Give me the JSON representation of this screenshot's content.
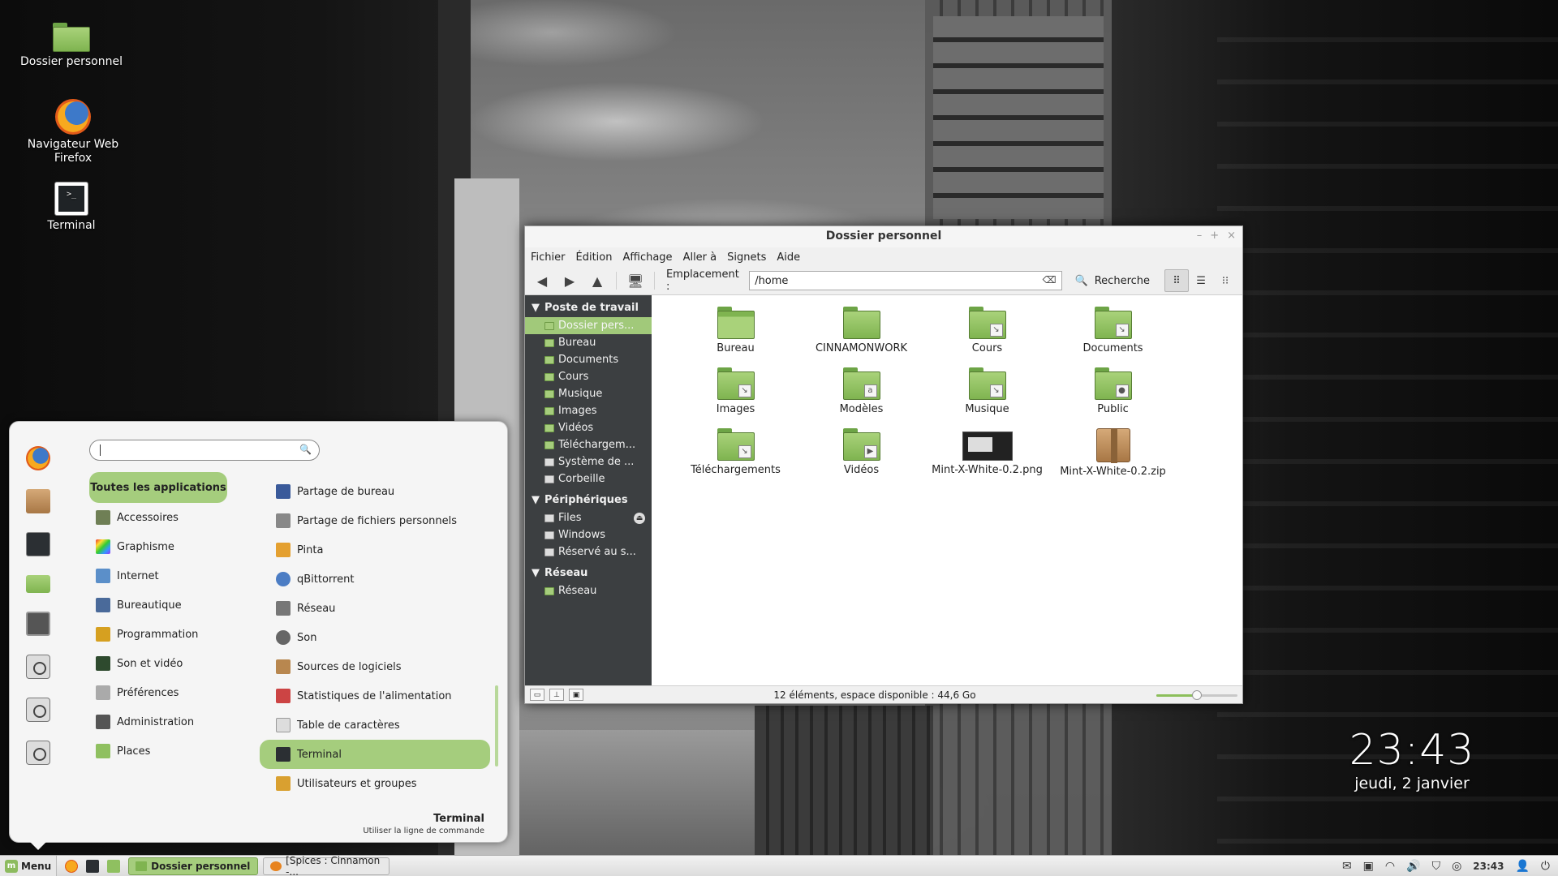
{
  "desktop": {
    "icons": [
      {
        "label": "Dossier personnel",
        "icon": "home-folder-icon"
      },
      {
        "label": "Navigateur Web\nFirefox",
        "label_line1": "Navigateur Web",
        "label_line2": "Firefox",
        "icon": "firefox-icon"
      },
      {
        "label": "Terminal",
        "icon": "terminal-icon"
      }
    ]
  },
  "file_manager": {
    "title": "Dossier personnel",
    "window_buttons": {
      "minimize": "–",
      "maximize": "+",
      "close": "×"
    },
    "menu": [
      "Fichier",
      "Édition",
      "Affichage",
      "Aller à",
      "Signets",
      "Aide"
    ],
    "location_label": "Emplacement :",
    "location_value": "/home",
    "search_label": "Recherche",
    "sidebar": {
      "sections": [
        {
          "title": "Poste de travail",
          "items": [
            {
              "label": "Dossier pers...",
              "selected": true
            },
            {
              "label": "Bureau"
            },
            {
              "label": "Documents"
            },
            {
              "label": "Cours"
            },
            {
              "label": "Musique"
            },
            {
              "label": "Images"
            },
            {
              "label": "Vidéos"
            },
            {
              "label": "Téléchargem..."
            },
            {
              "label": "Système de ..."
            },
            {
              "label": "Corbeille"
            }
          ]
        },
        {
          "title": "Périphériques",
          "items": [
            {
              "label": "Files"
            },
            {
              "label": "Windows"
            },
            {
              "label": "Réservé au s..."
            }
          ]
        },
        {
          "title": "Réseau",
          "items": [
            {
              "label": "Réseau"
            }
          ]
        }
      ]
    },
    "files": [
      {
        "name": "Bureau",
        "type": "folder"
      },
      {
        "name": "CINNAMONWORK",
        "type": "folder"
      },
      {
        "name": "Cours",
        "type": "folder-link"
      },
      {
        "name": "Documents",
        "type": "folder-link"
      },
      {
        "name": "Images",
        "type": "folder-link"
      },
      {
        "name": "Modèles",
        "type": "folder-link"
      },
      {
        "name": "Musique",
        "type": "folder-link"
      },
      {
        "name": "Public",
        "type": "folder-link"
      },
      {
        "name": "Téléchargements",
        "type": "folder-link"
      },
      {
        "name": "Vidéos",
        "type": "folder-link"
      },
      {
        "name": "Mint-X-White-0.2.png",
        "type": "image"
      },
      {
        "name": "Mint-X-White-0.2.zip",
        "type": "archive"
      }
    ],
    "status": "12 éléments, espace disponible : 44,6 Go",
    "zoom_level": 0.5
  },
  "start_menu": {
    "search_placeholder": "",
    "all_apps_label": "Toutes les applications",
    "favorites": [
      "firefox-icon",
      "package-icon",
      "terminal-icon",
      "folder-icon",
      "settings-icon",
      "lock-icon",
      "logout-icon",
      "power-icon"
    ],
    "categories": [
      "Accessoires",
      "Graphisme",
      "Internet",
      "Bureautique",
      "Programmation",
      "Son et vidéo",
      "Préférences",
      "Administration",
      "Places"
    ],
    "apps": [
      {
        "label": "Partage de bureau"
      },
      {
        "label": "Partage de fichiers personnels"
      },
      {
        "label": "Pinta"
      },
      {
        "label": "qBittorrent"
      },
      {
        "label": "Réseau"
      },
      {
        "label": "Son"
      },
      {
        "label": "Sources de logiciels"
      },
      {
        "label": "Statistiques de l'alimentation"
      },
      {
        "label": "Table de caractères"
      },
      {
        "label": "Terminal",
        "selected": true
      },
      {
        "label": "Utilisateurs et groupes"
      }
    ],
    "description_title": "Terminal",
    "description_text": "Utiliser la ligne de commande"
  },
  "clock": {
    "time": "23:43",
    "date": "jeudi, 2 janvier"
  },
  "panel": {
    "menu_label": "Menu",
    "tasks": [
      {
        "label": "Dossier personnel",
        "active": true
      },
      {
        "label": "[Spices : Cinnamon -...",
        "active": false
      }
    ],
    "tray_time": "23:43"
  }
}
